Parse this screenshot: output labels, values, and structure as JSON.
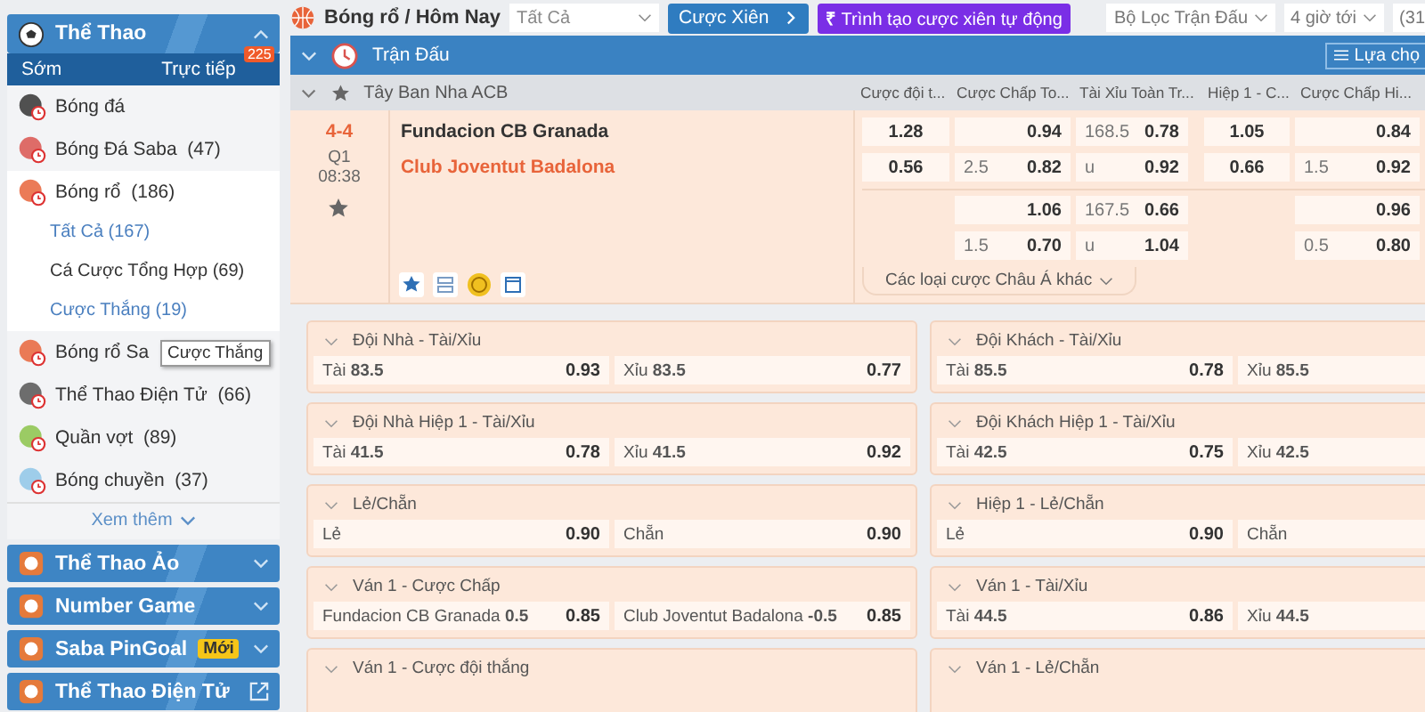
{
  "sidebar": {
    "header": {
      "title": "Thể Thao",
      "expanded": true
    },
    "tabs": [
      {
        "label": "Sớm"
      },
      {
        "label": "Trực tiếp",
        "badge": "225"
      }
    ],
    "items": [
      {
        "label": "Bóng đá",
        "expanded": false
      },
      {
        "label": "Bóng Đá Saba",
        "count": "(47)",
        "expanded": false
      },
      {
        "label": "Bóng rổ",
        "count": "(186)",
        "expanded": true,
        "children": [
          {
            "label": "Tất Cả (167)",
            "selected": true
          },
          {
            "label": "Cá Cược Tổng Hợp (69)",
            "selected": false
          },
          {
            "label": "Cược Thắng (19)",
            "selected": true
          }
        ]
      },
      {
        "label": "Bóng rổ Sa",
        "expanded": false
      },
      {
        "label": "Thể Thao Điện Tử",
        "count": "(66)",
        "expanded": false
      },
      {
        "label": "Quần vợt",
        "count": "(89)",
        "expanded": false
      },
      {
        "label": "Bóng chuyền",
        "count": "(37)",
        "expanded": false
      }
    ],
    "tooltip": "Cược Thắng",
    "more": "Xem thêm",
    "sections": [
      {
        "title": "Thể Thao Ảo",
        "kind": "collapse"
      },
      {
        "title": "Number Game",
        "kind": "collapse"
      },
      {
        "title": "Saba PinGoal",
        "badge": "Mới",
        "kind": "collapse"
      },
      {
        "title": "Thể Thao Điện Tử",
        "kind": "external"
      }
    ]
  },
  "toolbar": {
    "breadcrumb": "Bóng rổ / Hôm Nay",
    "select": {
      "value": "Tất Cả"
    },
    "parlay_button": "Cược Xiên",
    "auto_button": {
      "icon": "₹",
      "label": "Trình tạo cược xiên tự động"
    },
    "filters": [
      "Bộ Lọc Trận Đấu",
      "4 giờ tới"
    ],
    "date": "(31"
  },
  "section_bar": {
    "title": "Trận Đấu",
    "choose_button": "Lựa chọ"
  },
  "league": {
    "name": "Tây Ban Nha ACB",
    "columns": [
      "Cược đội t...",
      "Cược Chấp To...",
      "Tài Xỉu Toàn Tr...",
      "Hiệp 1 - C...",
      "Cược Chấp Hi..."
    ]
  },
  "match": {
    "score": "4-4",
    "period": "Q1",
    "clock": "08:38",
    "home": "Fundacion CB Granada",
    "away": "Club Joventut Badalona",
    "more_markets": "Các loại cược Châu Á khác",
    "groups": [
      {
        "rows": [
          [
            {
              "odds": "1.28"
            },
            {
              "odds": "0.94"
            },
            {
              "line": "168.5",
              "odds": "0.78"
            },
            {
              "odds": "1.05"
            },
            {
              "odds": "0.84"
            }
          ],
          [
            {
              "odds": "0.56"
            },
            {
              "line": "2.5",
              "odds": "0.82"
            },
            {
              "line": "u",
              "odds": "0.92"
            },
            {
              "odds": "0.66"
            },
            {
              "line": "1.5",
              "odds": "0.92"
            }
          ]
        ]
      },
      {
        "rows": [
          [
            null,
            {
              "odds": "1.06"
            },
            {
              "line": "167.5",
              "odds": "0.66"
            },
            null,
            {
              "odds": "0.96"
            }
          ],
          [
            null,
            {
              "line": "1.5",
              "odds": "0.70"
            },
            {
              "line": "u",
              "odds": "1.04"
            },
            null,
            {
              "line": "0.5",
              "odds": "0.80"
            }
          ]
        ]
      }
    ]
  },
  "markets": [
    {
      "title": "Đội Nhà - Tài/Xỉu",
      "outcomes": [
        {
          "label": "Tài **83.5**",
          "odds": "0.93"
        },
        {
          "label": "Xỉu **83.5**",
          "odds": "0.77"
        }
      ]
    },
    {
      "title": "Đội Khách - Tài/Xỉu",
      "outcomes": [
        {
          "label": "Tài **85.5**",
          "odds": "0.78"
        },
        {
          "label": "Xỉu **85.5**"
        }
      ]
    },
    {
      "title": "Đội Nhà Hiệp 1 - Tài/Xỉu",
      "outcomes": [
        {
          "label": "Tài **41.5**",
          "odds": "0.78"
        },
        {
          "label": "Xỉu **41.5**",
          "odds": "0.92"
        }
      ]
    },
    {
      "title": "Đội Khách Hiệp 1 - Tài/Xỉu",
      "outcomes": [
        {
          "label": "Tài **42.5**",
          "odds": "0.75"
        },
        {
          "label": "Xỉu **42.5**"
        }
      ]
    },
    {
      "title": "Lẻ/Chẵn",
      "outcomes": [
        {
          "label": "Lẻ",
          "odds": "0.90"
        },
        {
          "label": "Chẵn",
          "odds": "0.90"
        }
      ]
    },
    {
      "title": "Hiệp 1 - Lẻ/Chẵn",
      "outcomes": [
        {
          "label": "Lẻ",
          "odds": "0.90"
        },
        {
          "label": "Chẵn"
        }
      ]
    },
    {
      "title": "Ván 1 - Cược Chấp",
      "outcomes": [
        {
          "label": "Fundacion CB Granada **0.5**",
          "odds": "0.85"
        },
        {
          "label": "Club Joventut Badalona **-0.5**",
          "odds": "0.85"
        }
      ]
    },
    {
      "title": "Ván 1 - Tài/Xỉu",
      "outcomes": [
        {
          "label": "Tài **44.5**",
          "odds": "0.86"
        },
        {
          "label": "Xỉu **44.5**"
        }
      ]
    },
    {
      "title": "Ván 1 - Cược đội thắng"
    },
    {
      "title": "Ván 1 - Lẻ/Chẵn"
    }
  ]
}
